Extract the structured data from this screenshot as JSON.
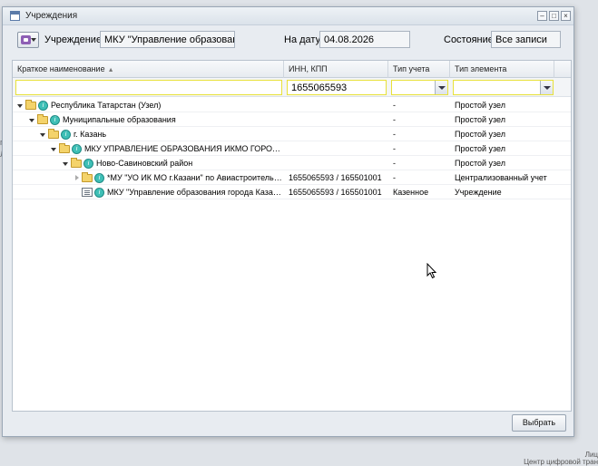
{
  "window": {
    "title": "Учреждения"
  },
  "toolbar": {
    "institution_label": "Учреждение:",
    "institution_value": "МКУ \"Управление образованием",
    "date_label": "На дату:",
    "date_value": "04.08.2026",
    "state_label": "Состояние:",
    "state_value": "Все записи"
  },
  "grid": {
    "columns": [
      "Краткое наименование",
      "ИНН, КПП",
      "Тип учета",
      "Тип элемента"
    ],
    "filter": {
      "name": "",
      "inn": "1655065593",
      "type_account": "",
      "type_element": ""
    },
    "rows": [
      {
        "name": "Республика Татарстан (Узел)",
        "inn": "",
        "account": "-",
        "element": "Простой узел",
        "icon": "folder-icon"
      },
      {
        "name": "Муниципальные образования",
        "inn": "",
        "account": "-",
        "element": "Простой узел",
        "icon": "folder-icon"
      },
      {
        "name": "г. Казань",
        "inn": "",
        "account": "-",
        "element": "Простой узел",
        "icon": "folder-icon"
      },
      {
        "name": "МКУ УПРАВЛЕНИЕ ОБРАЗОВАНИЯ ИКМО ГОРОДА КАЗ...",
        "inn": "",
        "account": "-",
        "element": "Простой узел",
        "icon": "folder-icon"
      },
      {
        "name": "Ново-Савиновский район",
        "inn": "",
        "account": "-",
        "element": "Простой узел",
        "icon": "folder-icon"
      },
      {
        "name": "*МУ \"УО ИК МО г.Казани\" по Авиастроительно...",
        "inn": "1655065593 / 165501001",
        "account": "-",
        "element": "Централизованный учет",
        "icon": "folder-icon"
      },
      {
        "name": "МКУ \"Управление образования города Казани\"",
        "inn": "1655065593 / 165501001",
        "account": "Казенное",
        "element": "Учреждение",
        "icon": "document-icon"
      }
    ]
  },
  "footer": {
    "select_label": "Выбрать"
  },
  "background": {
    "left_text_1": "пр",
    "left_text_2": "Л",
    "bottom_text_1": "Лиц",
    "bottom_text_2": "Центр цифровой тран"
  }
}
